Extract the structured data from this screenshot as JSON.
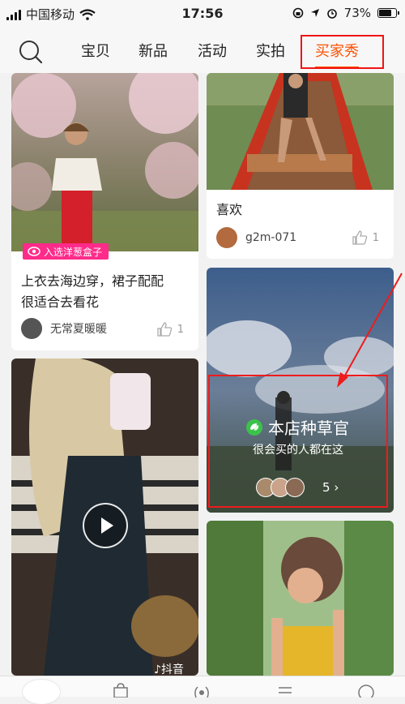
{
  "status_bar": {
    "carrier": "中国移动",
    "time": "17:56",
    "battery": "73%",
    "battery_level": 0.73
  },
  "nav": {
    "tabs": [
      {
        "label": "宝贝"
      },
      {
        "label": "新品"
      },
      {
        "label": "活动"
      },
      {
        "label": "实拍"
      },
      {
        "label": "买家秀",
        "active": true
      }
    ],
    "accent": "#ff5000"
  },
  "feed": {
    "card1": {
      "badge": "入选洋葱盒子",
      "title_line1": "上衣去海边穿，裙子配配",
      "title_line2": "很适合去看花",
      "author": "无常夏暖暖",
      "likes": "1"
    },
    "card2": {
      "title": "喜欢",
      "author": "g2m-071",
      "likes": "1"
    },
    "card3": {
      "title": "本店种草官",
      "subtitle": "很会买的人都在这",
      "count": "5"
    },
    "card4": {
      "platform": "抖音"
    }
  },
  "annotation_color": "#ee1c1c"
}
